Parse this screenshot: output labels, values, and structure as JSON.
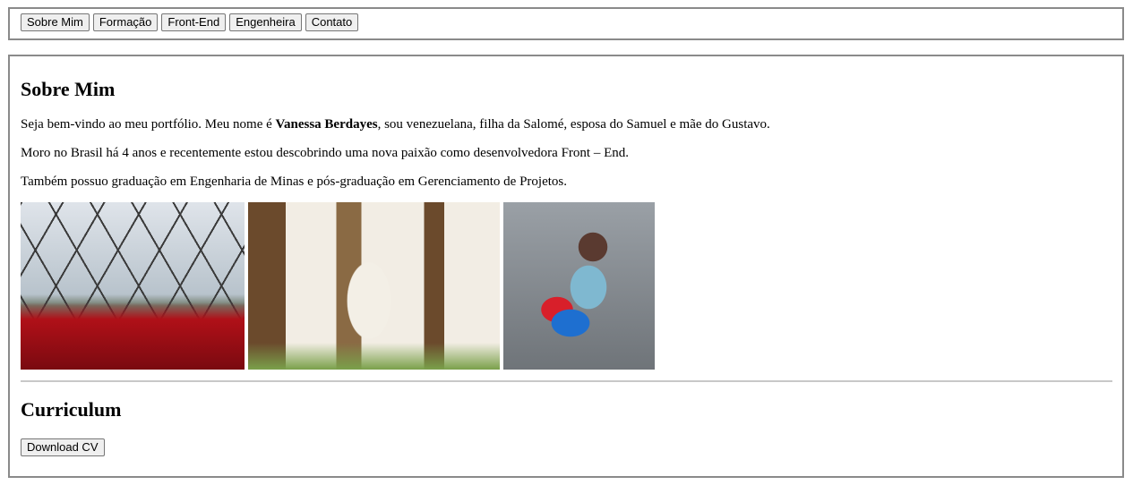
{
  "nav": {
    "items": [
      {
        "label": "Sobre Mim"
      },
      {
        "label": "Formação"
      },
      {
        "label": "Front-End"
      },
      {
        "label": "Engenheira"
      },
      {
        "label": "Contato"
      }
    ]
  },
  "about": {
    "title": "Sobre Mim",
    "p1_before": "Seja bem-vindo ao meu portfólio. Meu nome é ",
    "p1_name": "Vanessa Berdayes",
    "p1_after": ", sou venezuelana, filha da Salomé, esposa do Samuel e mãe do Gustavo.",
    "p2": "Moro no Brasil há 4 anos e recentemente estou descobrindo uma nova paixão como desenvolvedora Front – End.",
    "p3": "Também possuo graduação em Engenharia de Minas e pós-graduação em Gerenciamento de Projetos."
  },
  "curriculum": {
    "title": "Curriculum",
    "download_label": "Download CV"
  }
}
